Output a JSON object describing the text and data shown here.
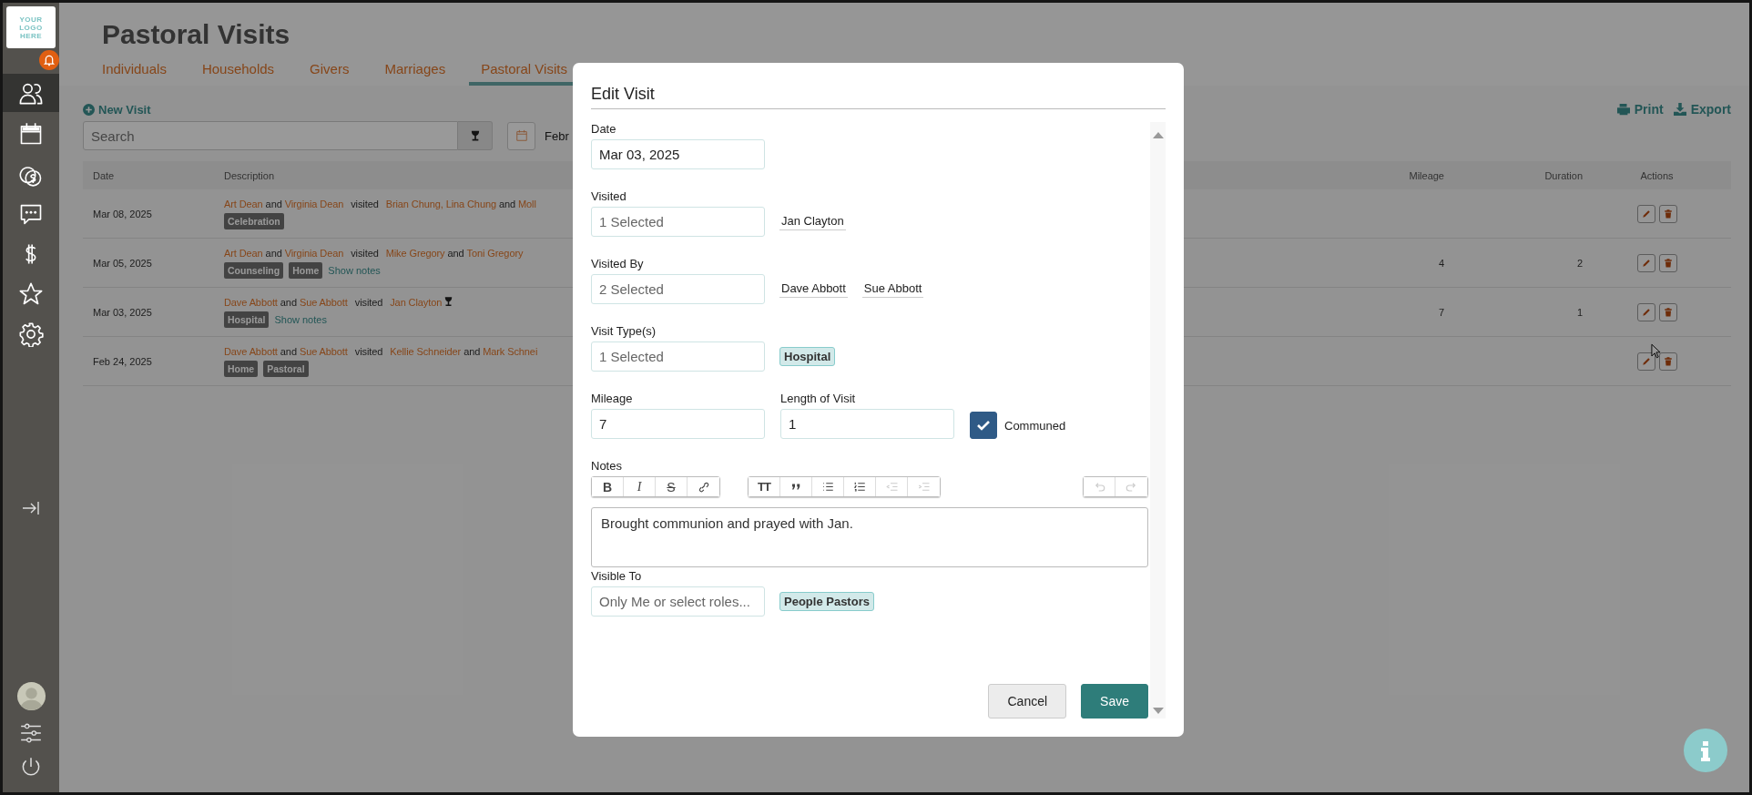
{
  "sidebar": {
    "logo": [
      "YOUR",
      "LOGO",
      "HERE"
    ],
    "nav": [
      {
        "kind": "people",
        "selected": true
      },
      {
        "kind": "calendar",
        "selected": false
      },
      {
        "kind": "coins",
        "selected": false
      },
      {
        "kind": "chat",
        "selected": false
      },
      {
        "kind": "dollar",
        "selected": false
      },
      {
        "kind": "star",
        "selected": false
      },
      {
        "kind": "gear",
        "selected": false
      }
    ],
    "bottom": [
      {
        "kind": "avatar"
      },
      {
        "kind": "sliders"
      },
      {
        "kind": "power"
      }
    ]
  },
  "page": {
    "title": "Pastoral Visits",
    "tabs": [
      {
        "label": "Individuals",
        "selected": false
      },
      {
        "label": "Households",
        "selected": false
      },
      {
        "label": "Givers",
        "selected": false
      },
      {
        "label": "Marriages",
        "selected": false
      },
      {
        "label": "Pastoral Visits",
        "selected": true
      }
    ],
    "new_visit": "New Visit",
    "search": {
      "placeholder": "Search"
    },
    "date_range": "Febr",
    "print": "Print",
    "export": "Export"
  },
  "table": {
    "columns": [
      "Date",
      "Description",
      "Mileage",
      "Duration",
      "Actions"
    ],
    "rows": [
      {
        "date": "Mar 08, 2025",
        "description": [
          {
            "text": "Art Dean",
            "kind": "name"
          },
          {
            "text": "and",
            "kind": "plain"
          },
          {
            "text": "Virginia Dean",
            "kind": "name"
          },
          {
            "text": "visited",
            "kind": "verb"
          },
          {
            "text": "Brian Chung, Lina Chung",
            "kind": "name"
          },
          {
            "text": "and",
            "kind": "plain"
          },
          {
            "text": "Moll",
            "kind": "name"
          }
        ],
        "communion": false,
        "tags": [
          "Celebration"
        ],
        "mileage": "",
        "duration": ""
      },
      {
        "date": "Mar 05, 2025",
        "description": [
          {
            "text": "Art Dean",
            "kind": "name"
          },
          {
            "text": "and",
            "kind": "plain"
          },
          {
            "text": "Virginia Dean",
            "kind": "name"
          },
          {
            "text": "visited",
            "kind": "verb"
          },
          {
            "text": "Mike Gregory",
            "kind": "name"
          },
          {
            "text": "and",
            "kind": "plain"
          },
          {
            "text": "Toni Gregory",
            "kind": "name"
          }
        ],
        "communion": false,
        "tags": [
          "Counseling",
          "Home"
        ],
        "show_notes": "Show notes",
        "mileage": "4",
        "duration": "2"
      },
      {
        "date": "Mar 03, 2025",
        "description": [
          {
            "text": "Dave Abbott",
            "kind": "name"
          },
          {
            "text": "and",
            "kind": "plain"
          },
          {
            "text": "Sue Abbott",
            "kind": "name"
          },
          {
            "text": "visited",
            "kind": "verb"
          },
          {
            "text": "Jan Clayton",
            "kind": "name"
          }
        ],
        "communion": true,
        "tags": [
          "Hospital"
        ],
        "show_notes": "Show notes",
        "mileage": "7",
        "duration": "1"
      },
      {
        "date": "Feb 24, 2025",
        "description": [
          {
            "text": "Dave Abbott",
            "kind": "name"
          },
          {
            "text": "and",
            "kind": "plain"
          },
          {
            "text": "Sue Abbott",
            "kind": "name"
          },
          {
            "text": "visited",
            "kind": "verb"
          },
          {
            "text": "Kellie Schneider",
            "kind": "name"
          },
          {
            "text": "and",
            "kind": "plain"
          },
          {
            "text": "Mark Schnei",
            "kind": "name"
          }
        ],
        "communion": false,
        "tags": [
          "Home",
          "Pastoral"
        ],
        "mileage": "",
        "duration": ""
      }
    ]
  },
  "modal": {
    "title": "Edit Visit",
    "date": {
      "label": "Date",
      "value": "Mar 03, 2025"
    },
    "selects": [
      {
        "label": "Visited",
        "summary": "1 Selected",
        "chips": [
          {
            "text": "Jan Clayton",
            "kind": "person"
          }
        ]
      },
      {
        "label": "Visited By",
        "summary": "2 Selected",
        "chips": [
          {
            "text": "Dave Abbott",
            "kind": "person"
          },
          {
            "text": "Sue Abbott",
            "kind": "person"
          }
        ]
      },
      {
        "label": "Visit Type(s)",
        "summary": "1 Selected",
        "chips": [
          {
            "text": "Hospital",
            "kind": "tag"
          }
        ]
      }
    ],
    "mileage": {
      "label": "Mileage",
      "value": "7"
    },
    "length": {
      "label": "Length of Visit",
      "value": "1"
    },
    "communed": {
      "label": "Communed",
      "checked": true
    },
    "notes": {
      "label": "Notes",
      "value": "Brought communion and prayed with Jan.",
      "toolbar": [
        [
          {
            "kind": "bold",
            "label": "B",
            "disabled": false
          },
          {
            "kind": "italic",
            "label": "I",
            "disabled": false
          },
          {
            "kind": "strike",
            "label": "S",
            "disabled": false
          },
          {
            "kind": "link",
            "disabled": false
          }
        ],
        [
          {
            "kind": "heading",
            "label": "TT",
            "disabled": false
          },
          {
            "kind": "quote",
            "disabled": false
          },
          {
            "kind": "bullets",
            "disabled": false
          },
          {
            "kind": "numbers",
            "disabled": false
          },
          {
            "kind": "outdent",
            "disabled": true
          },
          {
            "kind": "indent",
            "disabled": true
          }
        ],
        [
          {
            "kind": "undo",
            "disabled": true
          },
          {
            "kind": "redo",
            "disabled": true
          }
        ]
      ]
    },
    "visible_to": {
      "label": "Visible To",
      "placeholder": "Only Me or select roles...",
      "chips": [
        {
          "text": "People Pastors",
          "kind": "tag"
        }
      ]
    },
    "buttons": [
      {
        "label": "Cancel",
        "kind": "secondary"
      },
      {
        "label": "Save",
        "kind": "primary"
      }
    ]
  }
}
